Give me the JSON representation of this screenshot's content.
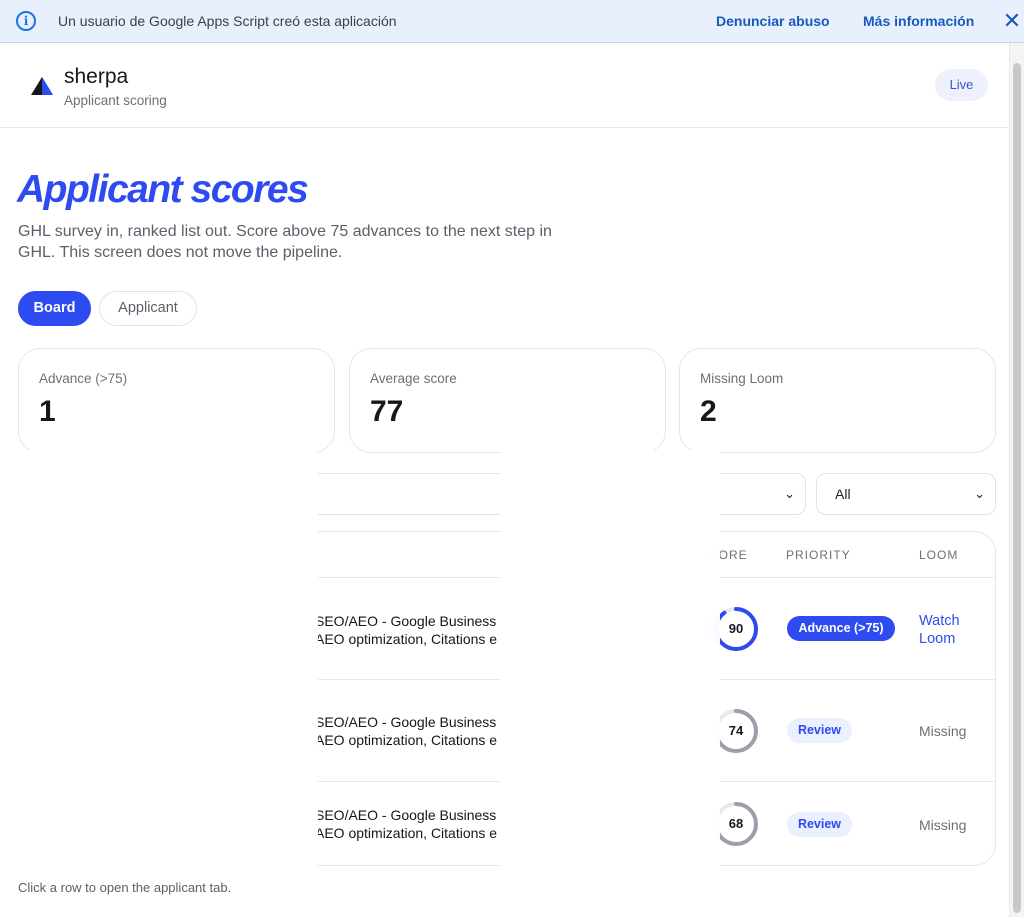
{
  "gas_banner": {
    "message": "Un usuario de Google Apps Script creó esta aplicación",
    "report_label": "Denunciar abuso",
    "more_label": "Más información",
    "info_icon": "i",
    "close_icon": "✕"
  },
  "header": {
    "brand": "sherpa",
    "subtitle": "Applicant scoring",
    "status": "Live"
  },
  "page": {
    "title": "Applicant scores",
    "description": "GHL survey in, ranked list out. Score above 75 advances to the next step in GHL. This screen does not move the pipeline."
  },
  "tabs": {
    "board": "Board",
    "applicant": "Applicant"
  },
  "stats": [
    {
      "label": "Advance (>75)",
      "value": "1"
    },
    {
      "label": "Average score",
      "value": "77"
    },
    {
      "label": "Missing Loom",
      "value": "2"
    }
  ],
  "filters": {
    "search_placeholder": "",
    "select1_value": "",
    "select2_value": "All",
    "chevron": "⌄"
  },
  "table": {
    "headers": {
      "score": "CORE",
      "priority": "PRIORITY",
      "loom": "LOOM"
    },
    "rows": [
      {
        "services_line1": "SEO/AEO - Google Business",
        "services_line2": "AEO optimization, Citations e",
        "score": 90,
        "score_label": "90",
        "priority": "Advance (>75)",
        "loom": "Watch Loom",
        "ring_color": "#2d4bf0"
      },
      {
        "services_line1": "SEO/AEO - Google Business",
        "services_line2": "AEO optimization, Citations e",
        "score": 74,
        "score_label": "74",
        "priority": "Review",
        "loom": "Missing",
        "ring_color": "#9aa0a8"
      },
      {
        "services_line1": "SEO/AEO - Google Business",
        "services_line2": "AEO optimization, Citations e",
        "score": 68,
        "score_label": "68",
        "priority": "Review",
        "loom": "Missing",
        "ring_color": "#9aa0a8"
      }
    ]
  },
  "footer": {
    "note": "Click a row to open the applicant tab."
  },
  "colors": {
    "accent": "#2d4bf0",
    "banner_bg": "#e8f0fe",
    "ring_track": "#e6e8ec"
  }
}
